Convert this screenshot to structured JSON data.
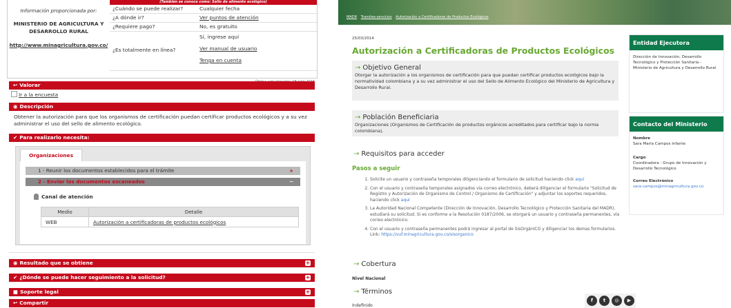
{
  "left": {
    "info": {
      "provided_by_label": "Información proporcionada por:",
      "org_line1": "MINISTERIO DE AGRICULTURA Y",
      "org_line2": "DESARROLLO RURAL",
      "url": "http://www.minagricultura.gov.co/",
      "also_known": "(También se conoce como: Sello de alimento ecológico)",
      "rows": [
        {
          "k": "¿Cuándo se puede realizar?",
          "v": "Cualquier fecha"
        },
        {
          "k": "¿A dónde ir?",
          "v": "Ver puntos de atención"
        },
        {
          "k": "¿Requiere pago?",
          "v": "No, es gratuito"
        },
        {
          "k": "¿Es totalmente en línea?",
          "v1": "Sí, ingrese aquí",
          "v2": "Ver manual de usuario",
          "v3": "Tenga en cuenta"
        }
      ],
      "updated": "Última actualización: 18 Julio 2016"
    },
    "valorar": "Valorar",
    "encuesta": "Ir a la encuesta",
    "descripcion": "Descripción",
    "desc_text": "Obtener la autorización para que los organismos de certificación puedan certificar productos ecológicos y a su vez administrar el uso del sello de alimento ecológico.",
    "para_realizarlo": "Para realizarlo necesita:",
    "tab_org": "Organizaciones",
    "acc1": "1 - Reunir los documentos establecidos para el trámite",
    "acc2": "2 - Enviar los documentos escaneados",
    "canal": "Canal de atención",
    "table_headers": [
      "Medio",
      "Detalle"
    ],
    "table_row": {
      "medio": "WEB",
      "detalle": "Autorización a certificadoras de productos ecológicos"
    },
    "resultado": "Resultado que se obtiene",
    "seguimiento": "¿Dónde se puede hacer seguimiento a la solicitud?",
    "soporte": "Soporte legal",
    "compartir": "Compartir"
  },
  "right": {
    "breadcrumb": [
      "MADR",
      "Tramites-servicios",
      "Autorización a Certificadoras de Productos Ecológicos"
    ],
    "date": "25/03/2014",
    "title": "Autorización a Certificadoras de Productos Ecológicos",
    "objetivo_title": "Objetivo General",
    "objetivo_text": "Otorgar la autorización a los organismos de certificación para que puedan certificar productos ecológicos bajo la normatividad colombiana y a su vez administrar el uso del Sello de Alimento Ecológico del Ministerio de Agricultura y Desarrollo Rural.",
    "poblacion_title": "Población Beneficiaria",
    "poblacion_text": "Organizaciones (Organismos de Certificación de productos orgánicos acreditados para certificar bajo la norma colombiana).",
    "requisitos_title": "Requisitos para acceder",
    "pasos_title": "Pasos a seguir",
    "steps": [
      {
        "text": "Solicite un usuario y contraseña temporales diligenciando el formulario de solicitud haciendo click ",
        "link": "aquí"
      },
      {
        "text": "Con el usuario y contraseña temporales asignados vía correo electrónico, deberá diligenciar el formulario \"Solicitud de Registro y Autorización de Organismo de Control / Organismo de Certificación\" y adjuntar los soportes requeridos, haciendo click ",
        "link": "aquí"
      },
      {
        "text": "La Autoridad Nacional Competente (Dirección de Innovación, Desarrollo Tecnológico y Protección Sanitaria del MADR), estudiará su solicitud. Si es conforme a la Resolución 0187/2006, se otorgará un usuario y contraseña permanentes, vía correo electrónico.",
        "link": ""
      },
      {
        "text": "Con el usuario y contraseña permanentes podrá ingresar al portal de SisOrgánICO y diligenciar los demas formularios. Link: ",
        "link": "https://vuf.minagricultura.gov.co/sisorganico"
      }
    ],
    "cobertura_title": "Cobertura",
    "cobertura_text": "Nivel Nacional",
    "terminos_title": "Términos",
    "terminos_text": "Indefinido",
    "entidad_title": "Entidad Ejecutora",
    "entidad_text": "Dirección de Innovación, Desarrollo Tecnológico y Protección Sanitaria - Ministerio de Agricultura y Desarrollo Rural",
    "contacto_title": "Contacto del Ministerio",
    "nombre_label": "Nombre",
    "nombre": "Sara María Campos Infante",
    "cargo_label": "Cargo",
    "cargo": "Coordinadora - Grupo de Innovación y Desarrollo Tecnológico",
    "correo_label": "Correo Electrónico",
    "correo": "sara.campos@minagricultura.gov.co",
    "social": [
      "f",
      "t",
      "◎",
      "▶"
    ]
  }
}
